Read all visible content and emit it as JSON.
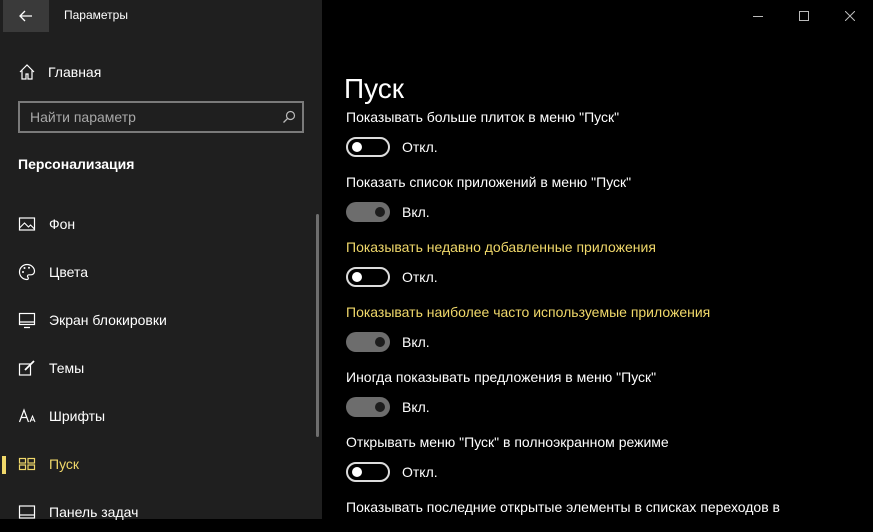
{
  "window": {
    "title": "Параметры",
    "controls": [
      "minimize-icon",
      "maximize-icon",
      "close-icon"
    ]
  },
  "sidebar": {
    "back_icon": "arrow-left-icon",
    "home": {
      "label": "Главная",
      "icon": "home-icon"
    },
    "search": {
      "placeholder": "Найти параметр",
      "value": "",
      "icon": "search-icon"
    },
    "section_title": "Персонализация",
    "items": [
      {
        "label": "Фон",
        "icon": "image-icon",
        "active": false
      },
      {
        "label": "Цвета",
        "icon": "palette-icon",
        "active": false
      },
      {
        "label": "Экран блокировки",
        "icon": "lock-screen-icon",
        "active": false
      },
      {
        "label": "Темы",
        "icon": "brush-icon",
        "active": false
      },
      {
        "label": "Шрифты",
        "icon": "font-icon",
        "active": false
      },
      {
        "label": "Пуск",
        "icon": "start-icon",
        "active": true
      },
      {
        "label": "Панель задач",
        "icon": "taskbar-icon",
        "active": false
      }
    ]
  },
  "main": {
    "title": "Пуск",
    "settings": [
      {
        "label": "Показывать больше плиток в меню \"Пуск\"",
        "state": "Откл.",
        "on": false
      },
      {
        "label": "Показать список приложений в меню \"Пуск\"",
        "state": "Вкл.",
        "on": true
      },
      {
        "label": "Показывать недавно добавленные приложения",
        "state": "Откл.",
        "on": false
      },
      {
        "label": "Показывать наиболее часто используемые приложения",
        "state": "Вкл.",
        "on": true
      },
      {
        "label": "Иногда показывать предложения в меню \"Пуск\"",
        "state": "Вкл.",
        "on": true
      },
      {
        "label": "Открывать меню \"Пуск\" в полноэкранном режиме",
        "state": "Откл.",
        "on": false
      },
      {
        "label": "Показывать последние открытые элементы в списках переходов в"
      }
    ]
  },
  "colors": {
    "sidebar_bg": "#1f1f1f",
    "content_bg": "#000000",
    "accent_yellow": "#f0d86a"
  }
}
